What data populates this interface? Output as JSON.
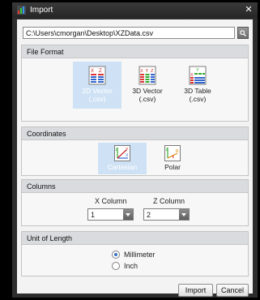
{
  "window": {
    "title": "Import"
  },
  "path": {
    "value": "C:\\Users\\cmorgan\\Desktop\\XZData.csv"
  },
  "file_format": {
    "header": "File Format",
    "options": [
      {
        "line1": "2D Vector",
        "line2": "(.csv)",
        "selected": true
      },
      {
        "line1": "3D Vector",
        "line2": "(.csv)",
        "selected": false
      },
      {
        "line1": "3D Table",
        "line2": "(.csv)",
        "selected": false
      }
    ]
  },
  "coordinates": {
    "header": "Coordinates",
    "options": [
      {
        "label": "Cartesian",
        "selected": true
      },
      {
        "label": "Polar",
        "selected": false
      }
    ]
  },
  "columns": {
    "header": "Columns",
    "x_label": "X Column",
    "z_label": "Z Column",
    "x_value": "1",
    "z_value": "2"
  },
  "unit_of_length": {
    "header": "Unit of Length",
    "options": [
      {
        "label": "Millimeter",
        "checked": true
      },
      {
        "label": "Inch",
        "checked": false
      }
    ]
  },
  "buttons": {
    "import": "Import",
    "cancel": "Cancel"
  },
  "colors": {
    "selected_bg": "#cfe2f5",
    "titlebar": "#2d2d2d",
    "panel": "#f3f3f3"
  }
}
